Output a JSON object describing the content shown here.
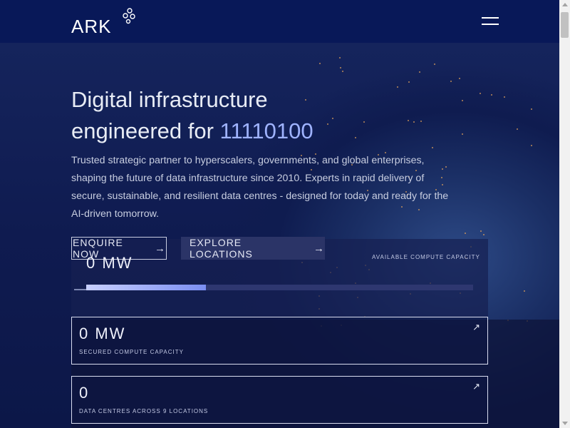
{
  "header": {
    "logo_text": "ARK",
    "menu_icon": "hamburger-icon"
  },
  "hero": {
    "title_line1": "Digital infrastructure",
    "title_line2_prefix": "engineered for ",
    "title_accent": "11110100",
    "description": "Trusted strategic partner to hyperscalers, governments, and global enterprises, shaping the future of data infrastructure since 2010. Experts in rapid delivery of secure, sustainable, and resilient data centres - designed for today and ready for the AI-driven tomorrow."
  },
  "buttons": {
    "enquire_label": "ENQUIRE NOW",
    "explore_label": "EXPLORE LOCATIONS",
    "arrow": "→"
  },
  "capacity": {
    "value": "0 MW",
    "label": "AVAILABLE COMPUTE CAPACITY",
    "progress_fraction": 0.31
  },
  "stats": [
    {
      "value": "0 MW",
      "label": "SECURED COMPUTE CAPACITY",
      "icon": "↗"
    },
    {
      "value": "0",
      "label": "DATA CENTRES ACROSS 9 LOCATIONS",
      "icon": "↗"
    }
  ],
  "colors": {
    "header_bg": "#081858",
    "accent": "#9fb3ff"
  }
}
